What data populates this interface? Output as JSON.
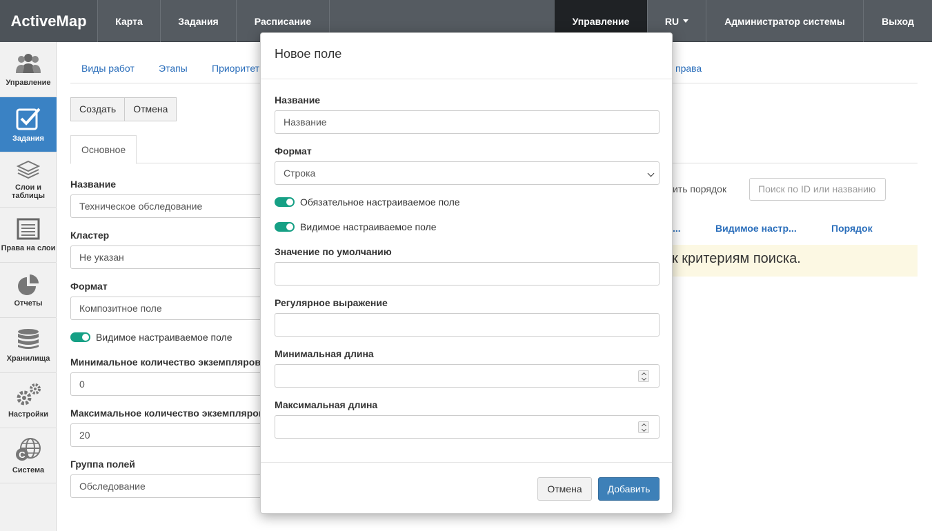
{
  "topnav": {
    "brand": "ActiveMap",
    "left_items": [
      "Карта",
      "Задания",
      "Расписание"
    ],
    "manage": "Управление",
    "lang": "RU",
    "user": "Администратор системы",
    "logout": "Выход"
  },
  "sidebar": {
    "items": [
      {
        "label": "Управление",
        "icon": "users-icon"
      },
      {
        "label": "Задания",
        "icon": "checkbox-icon"
      },
      {
        "label": "Слои и таблицы",
        "icon": "layers-icon"
      },
      {
        "label": "Права на слои",
        "icon": "list-icon"
      },
      {
        "label": "Отчеты",
        "icon": "pie-chart-icon"
      },
      {
        "label": "Хранилища",
        "icon": "database-icon"
      },
      {
        "label": "Настройки",
        "icon": "gears-icon"
      },
      {
        "label": "Система",
        "icon": "globe-icon"
      }
    ]
  },
  "page": {
    "subtabs": [
      "Виды работ",
      "Этапы",
      "Приоритеты",
      "права"
    ],
    "create_btn": "Создать",
    "cancel_btn": "Отмена",
    "tab_main": "Основное",
    "fields": {
      "name_label": "Название",
      "name_value": "Техническое обследование",
      "cluster_label": "Кластер",
      "cluster_value": "Не указан",
      "format_label": "Формат",
      "format_value": "Композитное поле",
      "visible_toggle": "Видимое настраиваемое поле",
      "min_label": "Минимальное количество экземпляров",
      "min_value": "0",
      "max_label": "Максимальное количество экземпляров",
      "max_value": "20",
      "group_label": "Группа полей",
      "group_value": "Обследование"
    },
    "right": {
      "order_text": "ить порядок",
      "search_placeholder": "Поиск по ID или названию",
      "col_truncated": "...",
      "col_visible": "Видимое настр...",
      "col_order": "Порядок",
      "no_results": "к критериям поиска."
    }
  },
  "modal": {
    "title": "Новое поле",
    "name_label": "Название",
    "name_placeholder": "Название",
    "format_label": "Формат",
    "format_value": "Строка",
    "required_toggle": "Обязательное настраиваемое поле",
    "visible_toggle": "Видимое настраиваемое поле",
    "default_label": "Значение по умолчанию",
    "regex_label": "Регулярное выражение",
    "minlen_label": "Минимальная длина",
    "maxlen_label": "Максимальная длина",
    "cancel": "Отмена",
    "add": "Добавить"
  }
}
